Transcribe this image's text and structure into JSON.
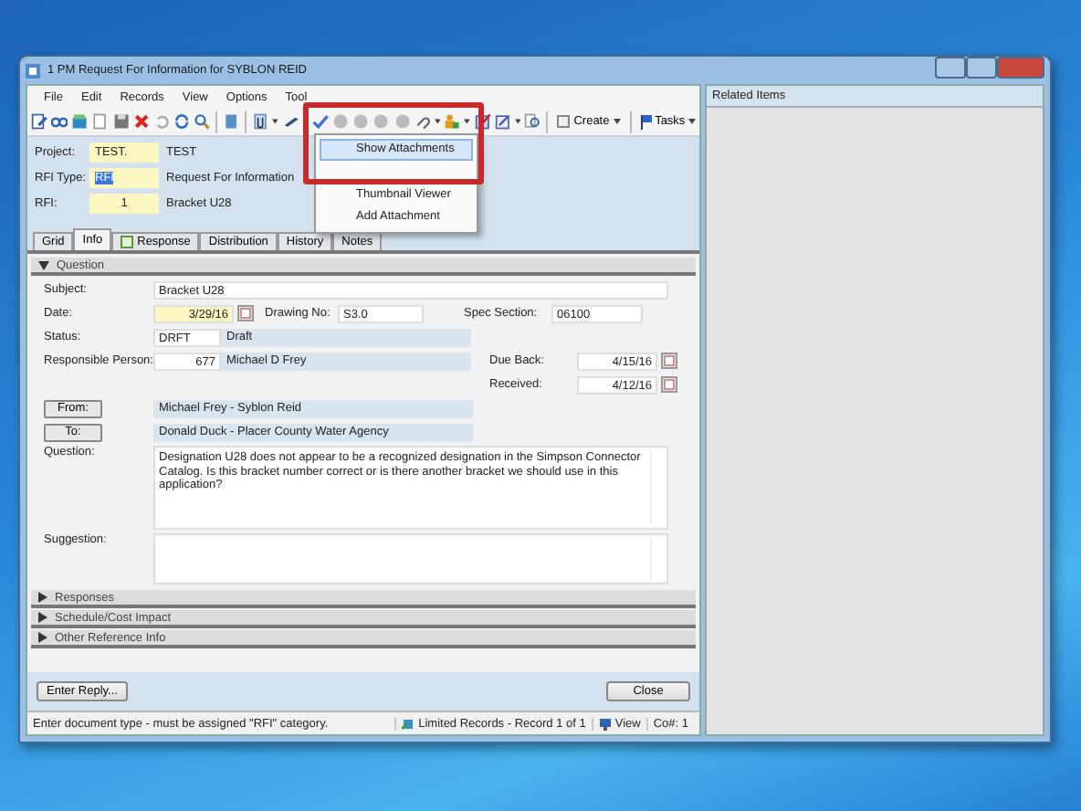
{
  "window": {
    "title": "1 PM Request For Information for SYBLON REID"
  },
  "menu": [
    "File",
    "Edit",
    "Records",
    "View",
    "Options",
    "Tool"
  ],
  "toolbar": {
    "buttons": [
      {
        "label": "Create"
      },
      {
        "label": "Tasks"
      }
    ]
  },
  "attachment_menu": {
    "items": [
      {
        "label": "Show Attachments",
        "selected": true
      },
      {
        "label": "Thumbnail Viewer",
        "selected": false
      },
      {
        "label": "Add Attachment",
        "selected": false
      }
    ]
  },
  "header": [
    {
      "label": "Project:",
      "code": "TEST.",
      "description": "TEST",
      "selected": false
    },
    {
      "label": "RFI Type:",
      "code": "RFI",
      "description": "Request For Information",
      "selected": true
    },
    {
      "label": "RFI:",
      "code": "1",
      "description": "Bracket U28",
      "selected": false
    }
  ],
  "tabs": [
    {
      "label": "Grid",
      "selected": false
    },
    {
      "label": "Info",
      "selected": true
    },
    {
      "label": "Response",
      "selected": false
    },
    {
      "label": "Distribution",
      "selected": false
    },
    {
      "label": "History",
      "selected": false
    },
    {
      "label": "Notes",
      "selected": false
    }
  ],
  "question": {
    "title": "Question",
    "expanded": true,
    "subject": {
      "label": "Subject:",
      "value": "Bracket U28"
    },
    "date": {
      "label": "Date:",
      "value": "3/29/16"
    },
    "drawing_no": {
      "label": "Drawing No:",
      "value": "S3.0"
    },
    "spec_section": {
      "label": "Spec Section:",
      "value": "06100"
    },
    "status": {
      "label": "Status:",
      "code": "DRFT",
      "description": "Draft"
    },
    "responsible_person": {
      "label": "Responsible Person:",
      "code": "677",
      "name": "Michael D Frey"
    },
    "due_back": {
      "label": "Due Back:",
      "value": "4/15/16"
    },
    "received": {
      "label": "Received:",
      "value": "4/12/16"
    },
    "from": {
      "button": "From:",
      "value": "Michael Frey - Syblon Reid"
    },
    "to": {
      "button": "To:",
      "value": "Donald Duck - Placer County Water Agency"
    },
    "question_text": {
      "label": "Question:",
      "value": "Designation U28 does not appear to be a recognized designation in the Simpson Connector Catalog.  Is this bracket number correct or is there another bracket we should use in this application?"
    },
    "suggestion": {
      "label": "Suggestion:"
    }
  },
  "sections": [
    {
      "title": "Responses",
      "expanded": false
    },
    {
      "title": "Schedule/Cost Impact",
      "expanded": false
    },
    {
      "title": "Other Reference Info",
      "expanded": false
    }
  ],
  "buttons": {
    "enter_reply": "Enter Reply...",
    "close": "Close"
  },
  "status_bar": {
    "message": "Enter document type - must be assigned \"RFI\" category.",
    "records": "Limited Records - Record 1 of 1",
    "view": "View",
    "company": "Co#: 1"
  },
  "related_items": {
    "title": "Related Items"
  }
}
